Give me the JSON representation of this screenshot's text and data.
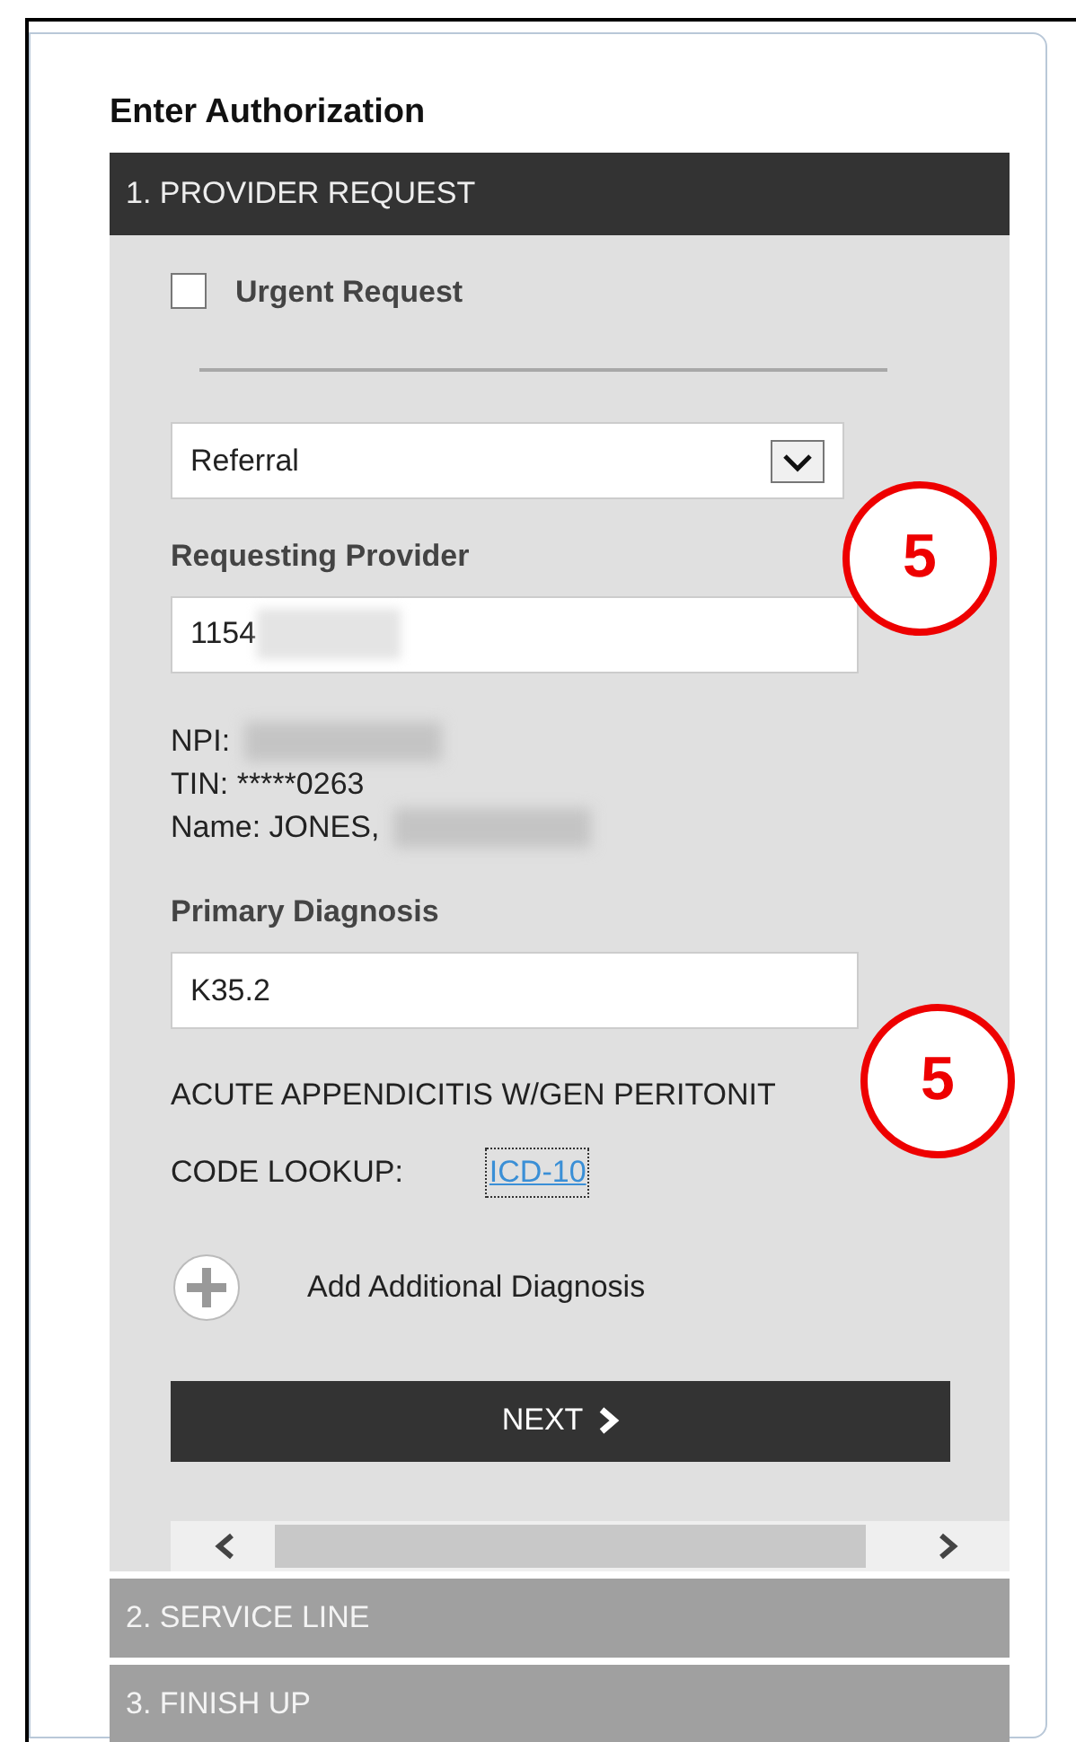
{
  "title": "Enter Authorization",
  "sections": [
    {
      "label": "1. PROVIDER REQUEST",
      "expanded": true
    },
    {
      "label": "2. SERVICE LINE",
      "expanded": false
    },
    {
      "label": "3. FINISH UP",
      "expanded": false
    }
  ],
  "urgent": {
    "label": "Urgent Request",
    "checked": false
  },
  "request_type": {
    "value": "Referral"
  },
  "requesting_provider": {
    "label": "Requesting Provider",
    "value": "1154"
  },
  "provider_info": [
    {
      "text": "NPI:",
      "redacted": true
    },
    {
      "text": "TIN: *****0263",
      "redacted": false
    },
    {
      "text": "Name: JONES,",
      "redacted": true
    }
  ],
  "primary_diagnosis": {
    "label": "Primary Diagnosis",
    "value": "K35.2",
    "description": "ACUTE APPENDICITIS W/GEN PERITONIT"
  },
  "code_lookup": {
    "label": "CODE LOOKUP:",
    "link": "ICD-10"
  },
  "add_diagnosis": {
    "label": "Add Additional Diagnosis"
  },
  "next_button": {
    "label": "NEXT"
  },
  "annotations": [
    {
      "text": "5"
    },
    {
      "text": "5"
    }
  ]
}
